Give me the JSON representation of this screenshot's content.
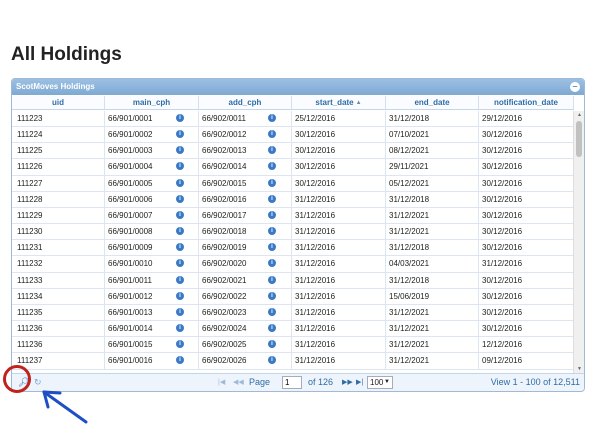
{
  "page": {
    "title": "All Holdings"
  },
  "grid": {
    "caption": "ScotMoves Holdings",
    "columns": [
      "uid",
      "main_cph",
      "add_cph",
      "start_date",
      "end_date",
      "notification_date"
    ],
    "sorted_column": "start_date",
    "rows": [
      [
        "111223",
        "66/901/0001",
        "66/902/0011",
        "25/12/2016",
        "31/12/2018",
        "29/12/2016"
      ],
      [
        "111224",
        "66/901/0002",
        "66/902/0012",
        "30/12/2016",
        "07/10/2021",
        "30/12/2016"
      ],
      [
        "111225",
        "66/901/0003",
        "66/902/0013",
        "30/12/2016",
        "08/12/2021",
        "30/12/2016"
      ],
      [
        "111226",
        "66/901/0004",
        "66/902/0014",
        "30/12/2016",
        "29/11/2021",
        "30/12/2016"
      ],
      [
        "111227",
        "66/901/0005",
        "66/902/0015",
        "30/12/2016",
        "05/12/2021",
        "30/12/2016"
      ],
      [
        "111228",
        "66/901/0006",
        "66/902/0016",
        "31/12/2016",
        "31/12/2018",
        "30/12/2016"
      ],
      [
        "111229",
        "66/901/0007",
        "66/902/0017",
        "31/12/2016",
        "31/12/2021",
        "30/12/2016"
      ],
      [
        "111230",
        "66/901/0008",
        "66/902/0018",
        "31/12/2016",
        "31/12/2021",
        "30/12/2016"
      ],
      [
        "111231",
        "66/901/0009",
        "66/902/0019",
        "31/12/2016",
        "31/12/2018",
        "30/12/2016"
      ],
      [
        "111232",
        "66/901/0010",
        "66/902/0020",
        "31/12/2016",
        "04/03/2021",
        "31/12/2016"
      ],
      [
        "111233",
        "66/901/0011",
        "66/902/0021",
        "31/12/2016",
        "31/12/2018",
        "30/12/2016"
      ],
      [
        "111234",
        "66/901/0012",
        "66/902/0022",
        "31/12/2016",
        "15/06/2019",
        "30/12/2016"
      ],
      [
        "111235",
        "66/901/0013",
        "66/902/0023",
        "31/12/2016",
        "31/12/2021",
        "30/12/2016"
      ],
      [
        "111236",
        "66/901/0014",
        "66/902/0024",
        "31/12/2016",
        "31/12/2021",
        "30/12/2016"
      ],
      [
        "111236",
        "66/901/0015",
        "66/902/0025",
        "31/12/2016",
        "31/12/2021",
        "12/12/2016"
      ],
      [
        "111237",
        "66/901/0016",
        "66/902/0026",
        "31/12/2016",
        "31/12/2021",
        "09/12/2016"
      ]
    ]
  },
  "pager": {
    "page_label": "Page",
    "page_value": "1",
    "of_label": "of 126",
    "rows_per_page": "100",
    "view_info": "View 1 - 100 of 12,511"
  },
  "icons": {
    "search": "search-icon",
    "refresh": "refresh-icon",
    "info": "info-icon",
    "first": "first-page-icon",
    "prev": "prev-page-icon",
    "next": "next-page-icon",
    "last": "last-page-icon"
  },
  "colors": {
    "caption_bg": "#7fa9d3",
    "header_text": "#2e6da4",
    "info_icon": "#3a7ac4",
    "annotation": "#c0231b",
    "arrow": "#1f4fc4"
  }
}
